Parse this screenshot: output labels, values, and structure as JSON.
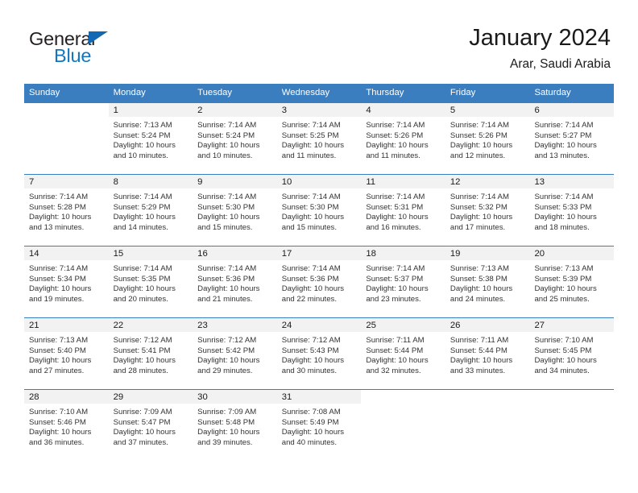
{
  "brand": {
    "name_part1": "General",
    "name_part2": "Blue",
    "triangle_icon": "blue-triangle-icon",
    "accent_color": "#1276bf"
  },
  "header": {
    "title": "January 2024",
    "subtitle": "Arar, Saudi Arabia"
  },
  "theme": {
    "header_bar_color": "#3a7ebf",
    "daynum_band_color": "#f2f2f2",
    "week_separator_color": "#3a7ebf",
    "text_color": "#333333"
  },
  "weekdays": [
    "Sunday",
    "Monday",
    "Tuesday",
    "Wednesday",
    "Thursday",
    "Friday",
    "Saturday"
  ],
  "labels": {
    "sunrise_prefix": "Sunrise:",
    "sunset_prefix": "Sunset:",
    "daylight_prefix": "Daylight:"
  },
  "weeks": [
    [
      {
        "day": "",
        "line1": "",
        "line2": "",
        "line3": "",
        "line4": ""
      },
      {
        "day": "1",
        "line1": "Sunrise: 7:13 AM",
        "line2": "Sunset: 5:24 PM",
        "line3": "Daylight: 10 hours",
        "line4": "and 10 minutes."
      },
      {
        "day": "2",
        "line1": "Sunrise: 7:14 AM",
        "line2": "Sunset: 5:24 PM",
        "line3": "Daylight: 10 hours",
        "line4": "and 10 minutes."
      },
      {
        "day": "3",
        "line1": "Sunrise: 7:14 AM",
        "line2": "Sunset: 5:25 PM",
        "line3": "Daylight: 10 hours",
        "line4": "and 11 minutes."
      },
      {
        "day": "4",
        "line1": "Sunrise: 7:14 AM",
        "line2": "Sunset: 5:26 PM",
        "line3": "Daylight: 10 hours",
        "line4": "and 11 minutes."
      },
      {
        "day": "5",
        "line1": "Sunrise: 7:14 AM",
        "line2": "Sunset: 5:26 PM",
        "line3": "Daylight: 10 hours",
        "line4": "and 12 minutes."
      },
      {
        "day": "6",
        "line1": "Sunrise: 7:14 AM",
        "line2": "Sunset: 5:27 PM",
        "line3": "Daylight: 10 hours",
        "line4": "and 13 minutes."
      }
    ],
    [
      {
        "day": "7",
        "line1": "Sunrise: 7:14 AM",
        "line2": "Sunset: 5:28 PM",
        "line3": "Daylight: 10 hours",
        "line4": "and 13 minutes."
      },
      {
        "day": "8",
        "line1": "Sunrise: 7:14 AM",
        "line2": "Sunset: 5:29 PM",
        "line3": "Daylight: 10 hours",
        "line4": "and 14 minutes."
      },
      {
        "day": "9",
        "line1": "Sunrise: 7:14 AM",
        "line2": "Sunset: 5:30 PM",
        "line3": "Daylight: 10 hours",
        "line4": "and 15 minutes."
      },
      {
        "day": "10",
        "line1": "Sunrise: 7:14 AM",
        "line2": "Sunset: 5:30 PM",
        "line3": "Daylight: 10 hours",
        "line4": "and 15 minutes."
      },
      {
        "day": "11",
        "line1": "Sunrise: 7:14 AM",
        "line2": "Sunset: 5:31 PM",
        "line3": "Daylight: 10 hours",
        "line4": "and 16 minutes."
      },
      {
        "day": "12",
        "line1": "Sunrise: 7:14 AM",
        "line2": "Sunset: 5:32 PM",
        "line3": "Daylight: 10 hours",
        "line4": "and 17 minutes."
      },
      {
        "day": "13",
        "line1": "Sunrise: 7:14 AM",
        "line2": "Sunset: 5:33 PM",
        "line3": "Daylight: 10 hours",
        "line4": "and 18 minutes."
      }
    ],
    [
      {
        "day": "14",
        "line1": "Sunrise: 7:14 AM",
        "line2": "Sunset: 5:34 PM",
        "line3": "Daylight: 10 hours",
        "line4": "and 19 minutes."
      },
      {
        "day": "15",
        "line1": "Sunrise: 7:14 AM",
        "line2": "Sunset: 5:35 PM",
        "line3": "Daylight: 10 hours",
        "line4": "and 20 minutes."
      },
      {
        "day": "16",
        "line1": "Sunrise: 7:14 AM",
        "line2": "Sunset: 5:36 PM",
        "line3": "Daylight: 10 hours",
        "line4": "and 21 minutes."
      },
      {
        "day": "17",
        "line1": "Sunrise: 7:14 AM",
        "line2": "Sunset: 5:36 PM",
        "line3": "Daylight: 10 hours",
        "line4": "and 22 minutes."
      },
      {
        "day": "18",
        "line1": "Sunrise: 7:14 AM",
        "line2": "Sunset: 5:37 PM",
        "line3": "Daylight: 10 hours",
        "line4": "and 23 minutes."
      },
      {
        "day": "19",
        "line1": "Sunrise: 7:13 AM",
        "line2": "Sunset: 5:38 PM",
        "line3": "Daylight: 10 hours",
        "line4": "and 24 minutes."
      },
      {
        "day": "20",
        "line1": "Sunrise: 7:13 AM",
        "line2": "Sunset: 5:39 PM",
        "line3": "Daylight: 10 hours",
        "line4": "and 25 minutes."
      }
    ],
    [
      {
        "day": "21",
        "line1": "Sunrise: 7:13 AM",
        "line2": "Sunset: 5:40 PM",
        "line3": "Daylight: 10 hours",
        "line4": "and 27 minutes."
      },
      {
        "day": "22",
        "line1": "Sunrise: 7:12 AM",
        "line2": "Sunset: 5:41 PM",
        "line3": "Daylight: 10 hours",
        "line4": "and 28 minutes."
      },
      {
        "day": "23",
        "line1": "Sunrise: 7:12 AM",
        "line2": "Sunset: 5:42 PM",
        "line3": "Daylight: 10 hours",
        "line4": "and 29 minutes."
      },
      {
        "day": "24",
        "line1": "Sunrise: 7:12 AM",
        "line2": "Sunset: 5:43 PM",
        "line3": "Daylight: 10 hours",
        "line4": "and 30 minutes."
      },
      {
        "day": "25",
        "line1": "Sunrise: 7:11 AM",
        "line2": "Sunset: 5:44 PM",
        "line3": "Daylight: 10 hours",
        "line4": "and 32 minutes."
      },
      {
        "day": "26",
        "line1": "Sunrise: 7:11 AM",
        "line2": "Sunset: 5:44 PM",
        "line3": "Daylight: 10 hours",
        "line4": "and 33 minutes."
      },
      {
        "day": "27",
        "line1": "Sunrise: 7:10 AM",
        "line2": "Sunset: 5:45 PM",
        "line3": "Daylight: 10 hours",
        "line4": "and 34 minutes."
      }
    ],
    [
      {
        "day": "28",
        "line1": "Sunrise: 7:10 AM",
        "line2": "Sunset: 5:46 PM",
        "line3": "Daylight: 10 hours",
        "line4": "and 36 minutes."
      },
      {
        "day": "29",
        "line1": "Sunrise: 7:09 AM",
        "line2": "Sunset: 5:47 PM",
        "line3": "Daylight: 10 hours",
        "line4": "and 37 minutes."
      },
      {
        "day": "30",
        "line1": "Sunrise: 7:09 AM",
        "line2": "Sunset: 5:48 PM",
        "line3": "Daylight: 10 hours",
        "line4": "and 39 minutes."
      },
      {
        "day": "31",
        "line1": "Sunrise: 7:08 AM",
        "line2": "Sunset: 5:49 PM",
        "line3": "Daylight: 10 hours",
        "line4": "and 40 minutes."
      },
      {
        "day": "",
        "line1": "",
        "line2": "",
        "line3": "",
        "line4": ""
      },
      {
        "day": "",
        "line1": "",
        "line2": "",
        "line3": "",
        "line4": ""
      },
      {
        "day": "",
        "line1": "",
        "line2": "",
        "line3": "",
        "line4": ""
      }
    ]
  ]
}
